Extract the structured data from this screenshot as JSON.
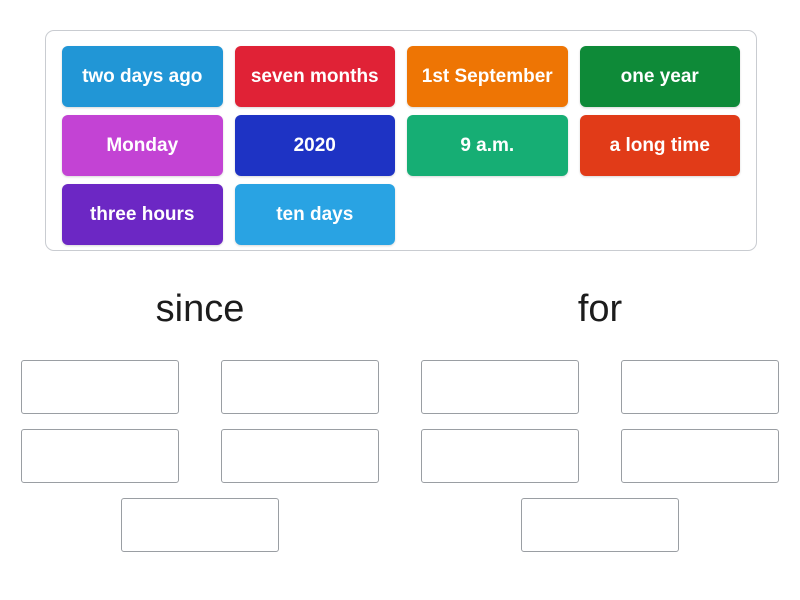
{
  "activity": {
    "type": "group-sort",
    "colors": {
      "sky_blue": "#2196d6",
      "crimson": "#e02236",
      "orange": "#ee7504",
      "forest_green": "#0e8a38",
      "orchid": "#c343d4",
      "navy": "#1e33c4",
      "emerald": "#16ae74",
      "red_orange": "#e13b18",
      "purple": "#6c27c4",
      "light_blue": "#29a3e3",
      "panel_border": "#c9ccd1",
      "slot_border": "#9a9ea3",
      "heading_text": "#1c1c1c",
      "tile_text": "#ffffff",
      "background": "#ffffff"
    }
  },
  "tile_bank": {
    "tiles": [
      {
        "label": "two days ago",
        "color": "#2196d6"
      },
      {
        "label": "seven months",
        "color": "#e02236"
      },
      {
        "label": "1st September",
        "color": "#ee7504"
      },
      {
        "label": "one year",
        "color": "#0e8a38"
      },
      {
        "label": "Monday",
        "color": "#c343d4"
      },
      {
        "label": "2020",
        "color": "#1e33c4"
      },
      {
        "label": "9 a.m.",
        "color": "#16ae74"
      },
      {
        "label": "a long time",
        "color": "#e13b18"
      },
      {
        "label": "three hours",
        "color": "#6c27c4"
      },
      {
        "label": "ten days",
        "color": "#29a3e3"
      }
    ]
  },
  "groups": [
    {
      "heading": "since",
      "slots": [
        "",
        "",
        "",
        "",
        ""
      ]
    },
    {
      "heading": "for",
      "slots": [
        "",
        "",
        "",
        "",
        ""
      ]
    }
  ]
}
